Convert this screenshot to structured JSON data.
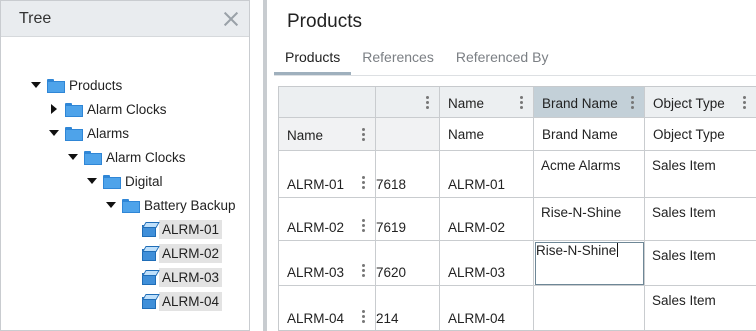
{
  "tree": {
    "title": "Tree",
    "nodes": [
      {
        "label": "Products",
        "expander": "down",
        "icon": "folder"
      },
      {
        "label": "Alarm Clocks",
        "expander": "right",
        "icon": "folder"
      },
      {
        "label": "Alarms",
        "expander": "down",
        "icon": "folder"
      },
      {
        "label": "Alarm Clocks",
        "expander": "down",
        "icon": "folder"
      },
      {
        "label": "Digital",
        "expander": "down",
        "icon": "folder"
      },
      {
        "label": "Battery Backup",
        "expander": "down",
        "icon": "folder"
      },
      {
        "label": "ALRM-01",
        "expander": "none",
        "icon": "item",
        "selected": true
      },
      {
        "label": "ALRM-02",
        "expander": "none",
        "icon": "item",
        "selected": true
      },
      {
        "label": "ALRM-03",
        "expander": "none",
        "icon": "item",
        "selected": true
      },
      {
        "label": "ALRM-04",
        "expander": "none",
        "icon": "item",
        "selected": true
      }
    ]
  },
  "main": {
    "title": "Products",
    "tabs": [
      "Products",
      "References",
      "Referenced By"
    ],
    "active_tab": "Products"
  },
  "grid": {
    "header": [
      "",
      "",
      "Name",
      "Brand Name",
      "Object Type"
    ],
    "filter_row": [
      "Name",
      "",
      "Name",
      "Brand Name",
      "Object Type"
    ],
    "rows": [
      {
        "name": "ALRM-01",
        "id": "7618",
        "name2": "ALRM-01",
        "brand": "Acme Alarms",
        "object_type": "Sales Item"
      },
      {
        "name": "ALRM-02",
        "id": "7619",
        "name2": "ALRM-02",
        "brand": "Rise-N-Shine",
        "object_type": "Sales Item"
      },
      {
        "name": "ALRM-03",
        "id": "7620",
        "name2": "ALRM-03",
        "brand": "Rise-N-Shine",
        "object_type": "Sales Item"
      },
      {
        "name": "ALRM-04",
        "id": "214",
        "name2": "ALRM-04",
        "brand": "",
        "object_type": "Sales Item"
      }
    ],
    "editing_row": 2,
    "highlight_column": "Brand Name"
  },
  "colors": {
    "brand_header_highlight": "#c3d0d8",
    "header_bg": "#eceff1",
    "folder_blue": "#4ea3ea",
    "selection_bg": "#e3e3e3"
  }
}
